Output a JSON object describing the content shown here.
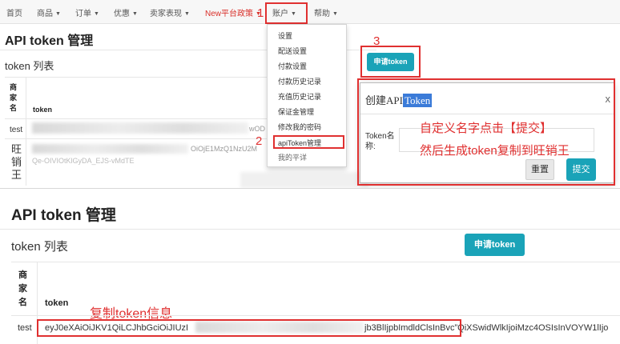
{
  "nav": {
    "items": [
      "首页",
      "商品",
      "订单",
      "优惠",
      "卖家表现",
      "New平台政策",
      "账户",
      "帮助"
    ]
  },
  "step_numbers": {
    "one": "1",
    "two": "2",
    "three": "3"
  },
  "page": {
    "title": "API token 管理",
    "subtitle": "token 列表",
    "apply_button": "申请token"
  },
  "table": {
    "headers": {
      "merchant_name": "商\n家\n名",
      "token": "token"
    },
    "top_rows": [
      {
        "name": "test",
        "token_fragment": "wOD"
      },
      {
        "name": "旺\n销\n王",
        "token_fragment": "OiOjE1MzQ1NzU2M",
        "token_fragment_2": "Qe-OIVIOtKlGyDA_EJS-vMdTE"
      }
    ],
    "bottom_row": {
      "name": "test",
      "token_start": "eyJ0eXAiOiJKV1QiLCJhbGciOiJIUzI",
      "token_end": "jb3BlIjpbImdldClsInBvc”QiXSwidWlkIjoiMzc4OSIsInVOYW1lIjo"
    }
  },
  "dropdown": {
    "items": [
      "设置",
      "配送设置",
      "付款设置",
      "付款历史记录",
      "充值历史记录",
      "保证金管理",
      "修改我的密码",
      "apiToken管理",
      "我的平详"
    ]
  },
  "dialog": {
    "title_prefix": "创建API",
    "title_highlight": "Token",
    "close": "x",
    "field_label": "Token名称:",
    "reset_button": "重置",
    "submit_button": "提交"
  },
  "annotations": {
    "line1": "自定义名字点击【提交】",
    "line2": "然后生成token复制到旺销王",
    "copy_hint": "复制token信息"
  },
  "colors": {
    "annotation_red": "#e03030",
    "button_teal": "#1aa3b8",
    "highlight_blue": "#3b7bd8"
  }
}
